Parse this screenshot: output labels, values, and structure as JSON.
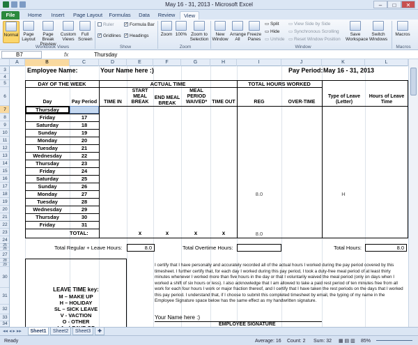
{
  "window": {
    "title": "May 16 - 31, 2013  -  Microsoft Excel",
    "min": "–",
    "max": "□",
    "close": "✕"
  },
  "tabs": [
    "File",
    "Home",
    "Insert",
    "Page Layout",
    "Formulas",
    "Data",
    "Review",
    "View"
  ],
  "ribbon": {
    "workbook_views": {
      "normal": "Normal",
      "page_layout": "Page Layout",
      "page_break": "Page Break Preview",
      "custom": "Custom Views",
      "full": "Full Screen",
      "group": "Workbook Views"
    },
    "show": {
      "ruler": "Ruler",
      "gridlines": "Gridlines",
      "formula_bar": "Formula Bar",
      "headings": "Headings",
      "group": "Show"
    },
    "zoom": {
      "zoom": "Zoom",
      "z100": "100%",
      "selection": "Zoom to Selection",
      "group": "Zoom"
    },
    "window": {
      "new": "New Window",
      "arrange": "Arrange All",
      "freeze": "Freeze Panes",
      "split": "Split",
      "hide": "Hide",
      "unhide": "Unhide",
      "side": "View Side by Side",
      "sync": "Synchronous Scrolling",
      "reset": "Reset Window Position",
      "save_ws": "Save Workspace",
      "switch": "Switch Windows",
      "group": "Window"
    },
    "macros": {
      "macros": "Macros",
      "group": "Macros"
    }
  },
  "formula_bar": {
    "cell": "B7",
    "fx": "fx",
    "content": "Thursday"
  },
  "columns": [
    "A",
    "B",
    "C",
    "D",
    "E",
    "F",
    "G",
    "H",
    "I",
    "J",
    "K",
    "L"
  ],
  "rows": [
    "3",
    "4",
    "5",
    "6",
    "7",
    "8",
    "9",
    "10",
    "11",
    "12",
    "13",
    "14",
    "15",
    "16",
    "17",
    "18",
    "19",
    "20",
    "21",
    "22",
    "23",
    "24",
    "25",
    "26",
    "27",
    "28",
    "29",
    "30",
    "31",
    "32",
    "33",
    "34"
  ],
  "sheet": {
    "employee_label": "Employee Name:",
    "employee_value": "Your Name here :)",
    "pay_period_label": "Pay Period:",
    "pay_period_value": "May 16 - 31, 2013",
    "h_day_of_week": "DAY OF THE WEEK",
    "h_actual_time": "ACTUAL TIME",
    "h_total_hours": "TOTAL HOURS WORKED",
    "h_day": "Day",
    "h_pay_period": "Pay Period",
    "h_time_in": "TIME IN",
    "h_start_meal": "START MEAL BREAK",
    "h_end_meal": "END MEAL BREAK",
    "h_meal_waived": "MEAL PERIOD WAIVED*",
    "h_time_out": "TIME OUT",
    "h_reg": "REG",
    "h_overtime": "OVER-TIME",
    "h_leave_type": "Type of Leave (Letter)",
    "h_leave_hours": "Hours of Leave Time",
    "days": [
      {
        "day": "Thursday",
        "pp": "16"
      },
      {
        "day": "Friday",
        "pp": "17"
      },
      {
        "day": "Saturday",
        "pp": "18"
      },
      {
        "day": "Sunday",
        "pp": "19"
      },
      {
        "day": "Monday",
        "pp": "20"
      },
      {
        "day": "Tuesday",
        "pp": "21"
      },
      {
        "day": "Wednesday",
        "pp": "22"
      },
      {
        "day": "Thursday",
        "pp": "23"
      },
      {
        "day": "Friday",
        "pp": "24"
      },
      {
        "day": "Saturday",
        "pp": "25"
      },
      {
        "day": "Sunday",
        "pp": "26"
      },
      {
        "day": "Monday",
        "pp": "27"
      },
      {
        "day": "Tuesday",
        "pp": "28"
      },
      {
        "day": "Wednesday",
        "pp": "29"
      },
      {
        "day": "Thursday",
        "pp": "30"
      },
      {
        "day": "Friday",
        "pp": "31"
      }
    ],
    "row27_reg": "8.0",
    "row27_leave": "H",
    "total_label": "TOTAL:",
    "total_x": "x",
    "total_reg": "8.0",
    "tot_reg_leave_label": "Total Regular + Leave Hours:",
    "tot_reg_leave_value": "8.0",
    "tot_ot_label": "Total Overtime Hours:",
    "tot_hours_label": "Total Hours:",
    "tot_hours_value": "8.0",
    "cert_text": "I certify that I have personally and accurately recorded all of the actual hours I worked during the pay period covered by this timesheet. I further certify that, for each day I worked during this pay period, I took a duty-free meal period of at least thirty minutes whenever I worked more than five hours in the day or that I voluntarily waived the meal period (only on days when I worked a shift of six hours or less). I also acknowledge that I am allowed to take a paid rest period of ten minutes free from all work for each four hours I work or major fraction thereof, and I certify that I have taken the rest periods on the days that I worked this pay period. I understand that, if I choose to submit this completed timesheet by email, the typing of my name in the Employee Signature space below has the same effect as my handwritten signature.",
    "leave_key_title": "LEAVE TIME key:",
    "leave_key": [
      "M – MAKE UP",
      "H – HOLIDAY",
      "SL – SICK LEAVE",
      "V - VACTION",
      "O - OTHER",
      "LA - LEAVE OF"
    ],
    "signature_name": "Your Name here :)",
    "signature_label": "EMPLOYEE SIGNATURE"
  },
  "sheet_tabs": [
    "Sheet1",
    "Sheet2",
    "Sheet3"
  ],
  "status": {
    "ready": "Ready",
    "average": "Average: 16",
    "count": "Count: 2",
    "sum": "Sum: 32",
    "zoom": "85%"
  }
}
